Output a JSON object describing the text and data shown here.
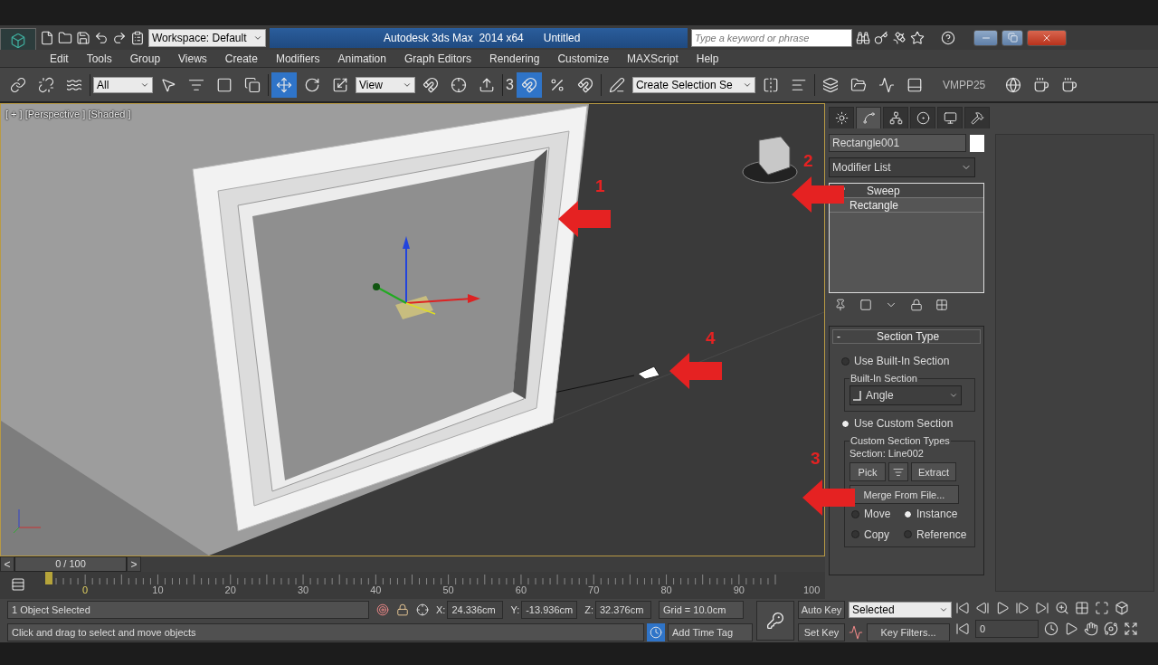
{
  "title_bar": {
    "workspace": "Workspace: Default",
    "title": "Autodesk 3ds Max  2014 x64",
    "document": "Untitled",
    "search": {
      "placeholder": "Type a keyword or phrase"
    }
  },
  "menu": [
    "Edit",
    "Tools",
    "Group",
    "Views",
    "Create",
    "Modifiers",
    "Animation",
    "Graph Editors",
    "Rendering",
    "Customize",
    "MAXScript",
    "Help"
  ],
  "toolbar": {
    "selection_filter": "All",
    "reference_system": "View",
    "snap_label": "3",
    "selection_set": "Create Selection Se",
    "plugin_label": "VMPP25"
  },
  "viewport": {
    "label": "[ + ] [Perspective ] [Shaded ]"
  },
  "annotations": [
    {
      "number": "1"
    },
    {
      "number": "2"
    },
    {
      "number": "3"
    },
    {
      "number": "4"
    }
  ],
  "command_panel": {
    "tabs": [
      {
        "selected": false
      },
      {
        "selected": true
      },
      {
        "selected": false
      },
      {
        "selected": false
      },
      {
        "selected": false
      },
      {
        "selected": false
      }
    ],
    "object_name": "Rectangle001",
    "modifier_list": "Modifier List",
    "stack": [
      {
        "label": "Sweep",
        "selected": true
      },
      {
        "label": "Rectangle",
        "selected": false
      }
    ],
    "rollout": {
      "toggle": "-",
      "title": "Section Type",
      "built_in": {
        "label": "Use Built-In Section",
        "selected": false
      },
      "built_in_group": "Built-In Section",
      "built_in_value": "Angle",
      "custom": {
        "label": "Use Custom Section",
        "selected": true
      },
      "custom_group": "Custom Section Types",
      "section": "Section: Line002",
      "pick": "Pick",
      "extract": "Extract",
      "merge": "Merge From File...",
      "modes": [
        {
          "label": "Move",
          "selected": false
        },
        {
          "label": "Instance",
          "selected": true
        },
        {
          "label": "Copy",
          "selected": false
        },
        {
          "label": "Reference",
          "selected": false
        }
      ]
    }
  },
  "time_slider": {
    "prev": "<",
    "position": "0 / 100",
    "next": ">"
  },
  "track_bar": {
    "ticks": [
      "0",
      "10",
      "20",
      "30",
      "40",
      "50",
      "60",
      "70",
      "80",
      "90",
      "100"
    ]
  },
  "status": {
    "selection": "1 Object Selected",
    "prompt": "Click and drag to select and move objects",
    "coordinates": [
      {
        "axis": "X:",
        "value": "24.336cm"
      },
      {
        "axis": "Y:",
        "value": "-13.936cm"
      },
      {
        "axis": "Z:",
        "value": "32.376cm"
      }
    ],
    "grid": "Grid = 10.0cm",
    "time_tag": "Add Time Tag",
    "auto_key": "Auto Key",
    "set_key": "Set Key",
    "key_mode": "Selected",
    "key_filters": "Key Filters...",
    "frame": "0"
  }
}
